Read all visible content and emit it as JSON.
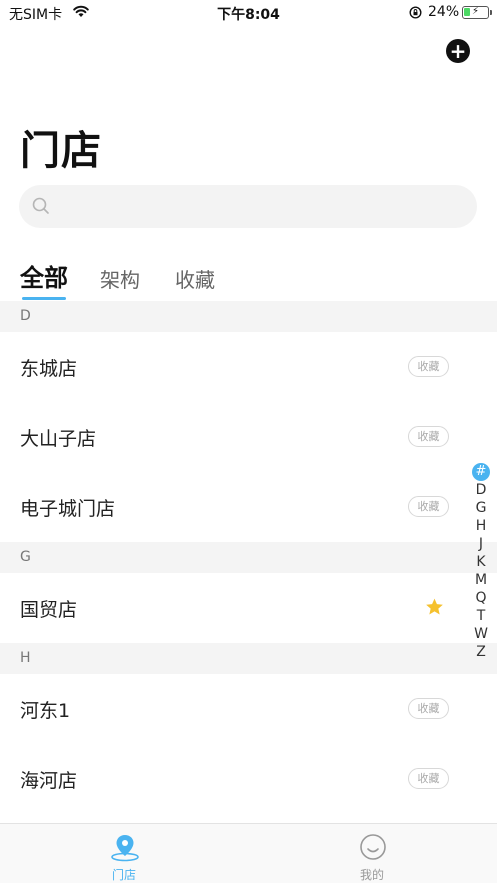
{
  "status_bar": {
    "carrier": "无SIM卡",
    "time": "下午8:04",
    "battery": "24%",
    "battery_level": 0.24
  },
  "header": {
    "title": "门店",
    "add_icon": "plus-circle-icon"
  },
  "search": {
    "placeholder": "",
    "value": ""
  },
  "tabs": [
    {
      "label": "全部",
      "active": true
    },
    {
      "label": "架构",
      "active": false
    },
    {
      "label": "收藏",
      "active": false
    }
  ],
  "sections": [
    {
      "letter": "D",
      "stores": [
        {
          "name": "东城店",
          "favorited": false,
          "fav_label": "收藏"
        },
        {
          "name": "大山子店",
          "favorited": false,
          "fav_label": "收藏"
        },
        {
          "name": "电子城门店",
          "favorited": false,
          "fav_label": "收藏"
        }
      ]
    },
    {
      "letter": "G",
      "stores": [
        {
          "name": "国贸店",
          "favorited": true,
          "fav_label": ""
        }
      ]
    },
    {
      "letter": "H",
      "stores": [
        {
          "name": "河东1",
          "favorited": false,
          "fav_label": "收藏"
        },
        {
          "name": "海河店",
          "favorited": false,
          "fav_label": "收藏"
        }
      ]
    }
  ],
  "index_letters": [
    "#",
    "D",
    "G",
    "H",
    "J",
    "K",
    "M",
    "Q",
    "T",
    "W",
    "Z"
  ],
  "bottom_tabs": [
    {
      "label": "门店",
      "icon": "location-pin-icon",
      "active": true
    },
    {
      "label": "我的",
      "icon": "smiley-face-icon",
      "active": false
    }
  ],
  "colors": {
    "accent": "#4ab3f0",
    "star": "#f5c12e"
  }
}
